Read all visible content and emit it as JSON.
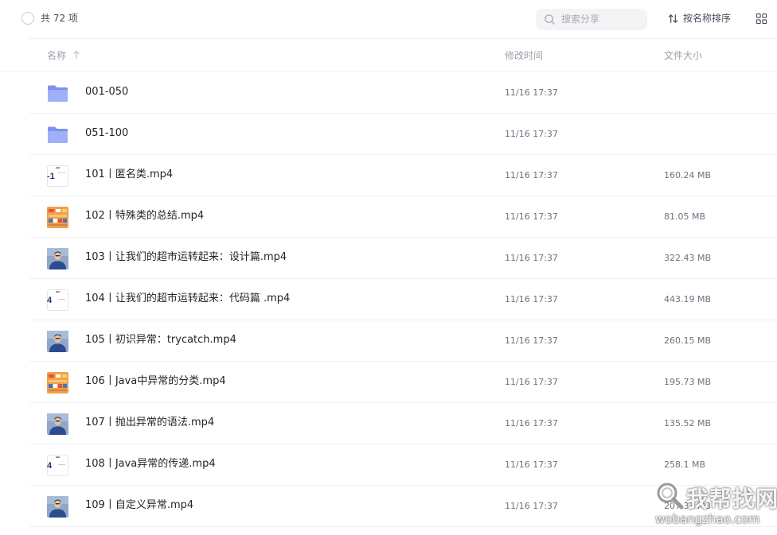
{
  "toolbar": {
    "count_label": "共 72 项",
    "search_placeholder": "搜索分享",
    "sort_label": "按名称排序"
  },
  "table": {
    "columns": {
      "name": "名称",
      "modified": "修改时间",
      "size": "文件大小"
    },
    "rows": [
      {
        "name": "001-050",
        "modified": "11/16 17:37",
        "size": "",
        "kind": "folder"
      },
      {
        "name": "051-100",
        "modified": "11/16 17:37",
        "size": "",
        "kind": "folder"
      },
      {
        "name": "101丨匿名类.mp4",
        "modified": "11/16 17:37",
        "size": "160.24 MB",
        "kind": "slide",
        "thumb_text": "-1"
      },
      {
        "name": "102丨特殊类的总结.mp4",
        "modified": "11/16 17:37",
        "size": "81.05 MB",
        "kind": "orange"
      },
      {
        "name": "103丨让我们的超市运转起来：设计篇.mp4",
        "modified": "11/16 17:37",
        "size": "322.43 MB",
        "kind": "person"
      },
      {
        "name": "104丨让我们的超市运转起来：代码篇 .mp4",
        "modified": "11/16 17:37",
        "size": "443.19 MB",
        "kind": "slide",
        "thumb_text": "4"
      },
      {
        "name": "105丨初识异常：trycatch.mp4",
        "modified": "11/16 17:37",
        "size": "260.15 MB",
        "kind": "person"
      },
      {
        "name": "106丨Java中异常的分类.mp4",
        "modified": "11/16 17:37",
        "size": "195.73 MB",
        "kind": "orange"
      },
      {
        "name": "107丨抛出异常的语法.mp4",
        "modified": "11/16 17:37",
        "size": "135.52 MB",
        "kind": "person"
      },
      {
        "name": "108丨Java异常的传递.mp4",
        "modified": "11/16 17:37",
        "size": "258.1 MB",
        "kind": "slide",
        "thumb_text": "4"
      },
      {
        "name": "109丨自定义异常.mp4",
        "modified": "11/16 17:37",
        "size": "207.33 MB",
        "kind": "person"
      }
    ]
  },
  "watermark": {
    "brand": "我帮找网",
    "url": "wobangzhao.com"
  },
  "colors": {
    "folder": "#8ea0f5",
    "folder_dark": "#7f8ff0",
    "orange_thumb": "#f0a04b",
    "person_bg": "#8fa8c8",
    "person_shirt": "#2d4b8f"
  }
}
